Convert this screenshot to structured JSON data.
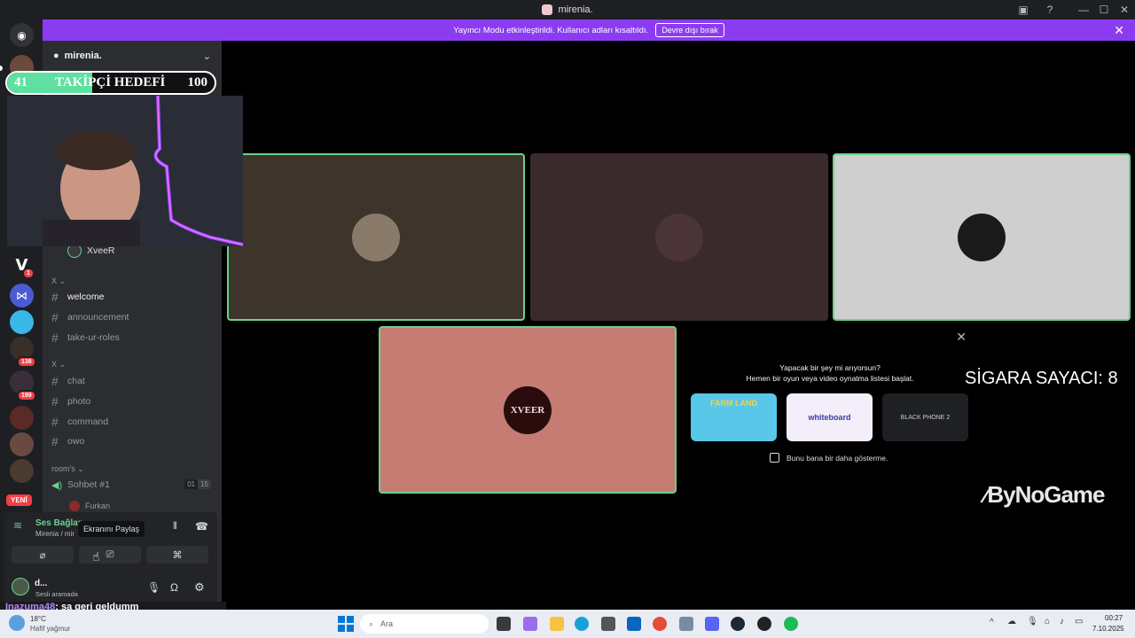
{
  "window": {
    "title": "mirenia."
  },
  "notice": {
    "text": "Yayıncı Modu etkinleştirildi. Kullanıcı adları kısaltıldı.",
    "button": "Devre dışı bırak"
  },
  "rail": {
    "badges": [
      "1",
      "138",
      "199"
    ],
    "new_label": "YENİ"
  },
  "sidebar": {
    "server_name": "mirenia.",
    "streamer_name": "XveeR",
    "categories": {
      "a": "X",
      "b": "X",
      "rooms": "room's"
    },
    "channels": [
      "welcome",
      "announcement",
      "take-ur-roles",
      "chat",
      "photo",
      "command",
      "owo"
    ],
    "voice_channel": {
      "name": "Sohbet #1",
      "count_a": "01",
      "count_b": "15"
    },
    "voice_member": "Furkan"
  },
  "voice_panel": {
    "status": "Ses Bağlan",
    "location": "Mirenia / mir",
    "tooltip": "Ekranını Paylaş",
    "user_name": "d...",
    "user_status": "Sesli aramada"
  },
  "activity": {
    "line1": "Yapacak bir şey mi arıyorsun?",
    "line2": "Hemen bir oyun veya video oynatma listesi başlat.",
    "games": [
      "FARM LAND",
      "whiteboard",
      "BLACK PHONE 2"
    ],
    "checkbox_label": "Bunu bana bir daha gösterme."
  },
  "tiles": {
    "xveer_avatar_text": "XVEER"
  },
  "overlay": {
    "follow_current": "41",
    "follow_label": "TAKİPÇİ HEDEFİ",
    "follow_goal": "100",
    "follow_progress": 0.41,
    "cigarette_counter": "SİGARA SAYACI: 8",
    "brand": "ByNoGame",
    "chat_user": "Inazuma48",
    "chat_message": ": sa geri geldumm"
  },
  "taskbar": {
    "weather_temp": "18°C",
    "weather_desc": "Hafif yağmur",
    "search_placeholder": "Ara",
    "time": "00:27",
    "date": "7.10.2025"
  },
  "colors": {
    "discord_purple": "#8c3cf0",
    "tile_1": "#3d352c",
    "tile_2": "#3b2a2c",
    "tile_3": "#cfcfcf",
    "tile_4": "#c57c72",
    "speaking": "#6bd08c"
  }
}
